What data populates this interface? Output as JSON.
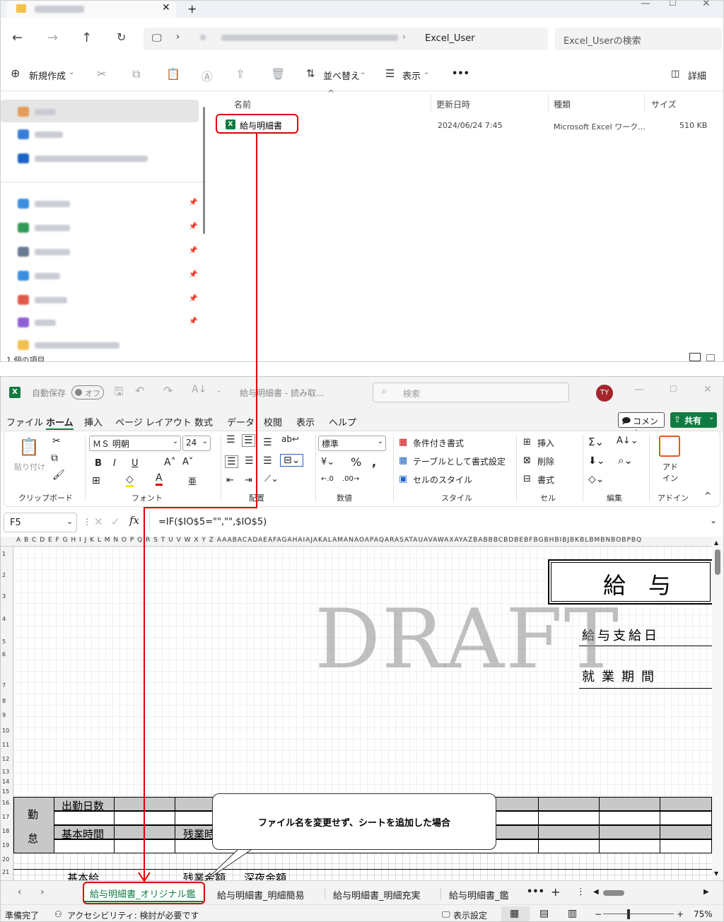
{
  "explorer": {
    "address_current": "Excel_User",
    "search_placeholder": "Excel_Userの検索",
    "toolbar": {
      "new_label": "新規作成",
      "sort_label": "並べ替え",
      "view_label": "表示",
      "more_label": "•••",
      "details_label": "詳細"
    },
    "columns": {
      "name": "名前",
      "modified": "更新日時",
      "type": "種類",
      "size": "サイズ"
    },
    "file": {
      "name": "給与明細書",
      "modified": "2024/06/24 7:45",
      "type": "Microsoft Excel ワーク...",
      "size": "510 KB"
    },
    "status_text": "1 個の項目"
  },
  "excel": {
    "autosave_label": "自動保存",
    "autosave_state": "オフ",
    "title": "給与明細書 - 読み取...",
    "search_placeholder": "検索",
    "user_initials": "TY",
    "menu": [
      "ファイル",
      "ホーム",
      "挿入",
      "ページ レイアウト",
      "数式",
      "データ",
      "校閲",
      "表示",
      "ヘルプ"
    ],
    "comment_label": "コメント",
    "share_label": "共有",
    "ribbon": {
      "paste_label": "貼り付け",
      "font_name": "ＭＳ 明朝",
      "font_size": "24",
      "number_format": "標準",
      "cond_format": "条件付き書式",
      "table_format": "テーブルとして書式設定",
      "cell_style": "セルのスタイル",
      "insert": "挿入",
      "delete": "削除",
      "format": "書式",
      "addin": "アドイン",
      "groups": [
        "クリップボード",
        "フォント",
        "配置",
        "数値",
        "スタイル",
        "セル",
        "編集",
        "アドイン"
      ]
    },
    "name_box": "F5",
    "formula": "=IF($IO$5=\"\",\"\",$IO$5)",
    "column_headers": "A B C D E F G H I J K L M N O P Q R S T U V W X Y Z AAABACADAEAFAGAHAIAJAKALAMANAOAPAQARASATAUAVAWAXAYAZBABBBCBDBEBFBGBHBIBJBKBLBMBNBOBPBQ",
    "row_numbers": [
      "1",
      "2",
      "3",
      "4",
      "5",
      "6",
      "7",
      "8",
      "9",
      "10",
      "11",
      "12",
      "13",
      "14",
      "15",
      "16",
      "17",
      "18",
      "19",
      "20",
      "21"
    ],
    "sheet": {
      "watermark": "DRAFT",
      "title_partial": "給　与",
      "pay_date_label": "給与支給日",
      "work_period_label": "就業期間",
      "attendance_label_1": "勤",
      "attendance_label_2": "怠",
      "work_days": "出勤日数",
      "basic_hours": "基本時間",
      "overtime_hours": "残業時",
      "basic_pay": "基本給",
      "overtime_pay": "残業金額",
      "night_pay": "深夜金額"
    },
    "tabs": [
      "給与明細書_オリジナル鑑",
      "給与明細書_明細簡易",
      "給与明細書_明細充実",
      "給与明細書_鑑"
    ],
    "status_ready": "準備完了",
    "accessibility": "アクセシビリティ: 検討が必要です",
    "display_settings": "表示設定",
    "zoom": "75%"
  },
  "annotation": {
    "callout_text": "ファイル名を変更せず、シートを追加した場合"
  },
  "colors": {
    "annotation_red": "#e00000",
    "excel_green": "#107c41",
    "sheet_gray": "#c8c8c8"
  }
}
